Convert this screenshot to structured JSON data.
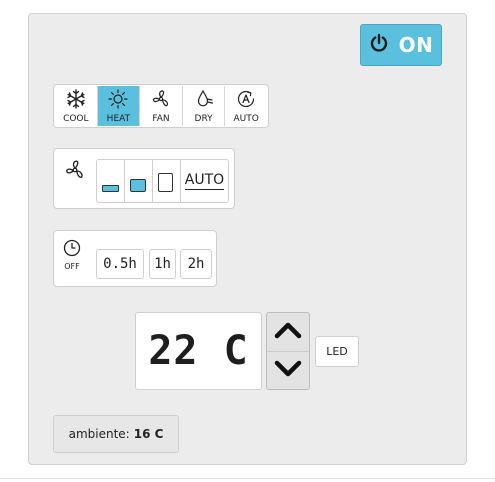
{
  "power": {
    "label": "ON",
    "state": "on",
    "accent": "#5bc0de",
    "icon": "power-icon"
  },
  "modes": [
    {
      "key": "cool",
      "label": "COOL",
      "icon": "snowflake-icon",
      "active": false
    },
    {
      "key": "heat",
      "label": "HEAT",
      "icon": "sun-icon",
      "active": true
    },
    {
      "key": "fan",
      "label": "FAN",
      "icon": "fan-icon",
      "active": false
    },
    {
      "key": "dry",
      "label": "DRY",
      "icon": "droplet-icon",
      "active": false
    },
    {
      "key": "auto",
      "label": "AUTO",
      "icon": "auto-a-icon",
      "active": false
    }
  ],
  "fan_speed": {
    "icon": "fan-icon",
    "options": [
      "low",
      "medium",
      "high"
    ],
    "auto_label": "AUTO"
  },
  "timer": {
    "icon": "clock-icon",
    "off_label": "OFF",
    "options": [
      "0.5h",
      "1h",
      "2h"
    ]
  },
  "temperature": {
    "display": "22 C",
    "up_icon": "chevron-up-icon",
    "down_icon": "chevron-down-icon"
  },
  "led": {
    "label": "LED"
  },
  "ambient": {
    "label": "ambiente:",
    "value": "16 C"
  }
}
